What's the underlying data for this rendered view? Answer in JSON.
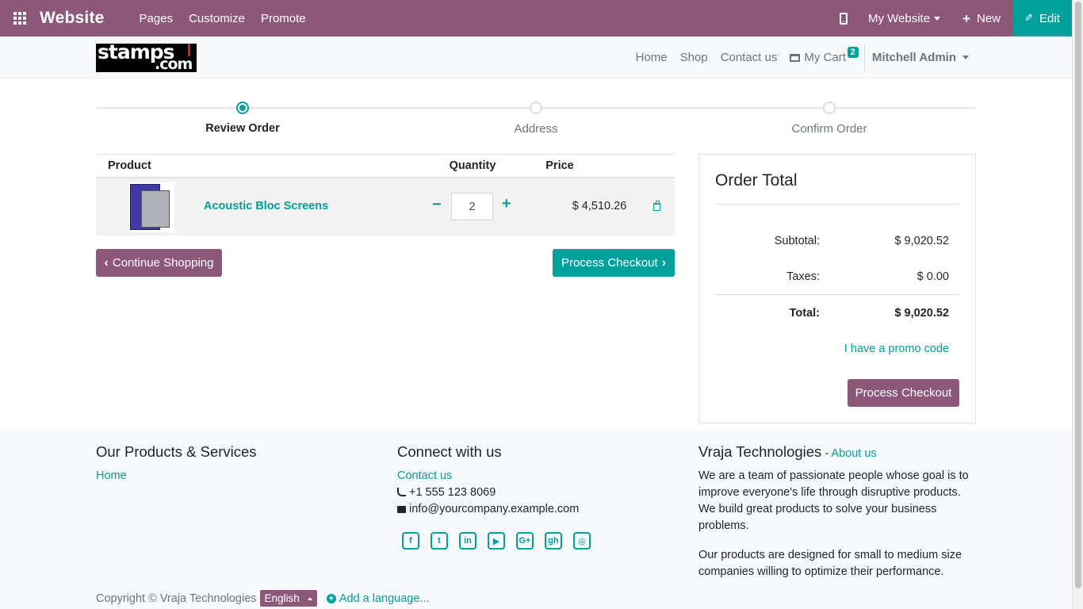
{
  "topbar": {
    "brand": "Website",
    "nav": [
      "Pages",
      "Customize",
      "Promote"
    ],
    "my_website": "My Website",
    "new_label": "New",
    "edit_label": "Edit",
    "bg_color": "#8c5779",
    "accent_color": "#00a09d"
  },
  "header": {
    "logo_line1": "stamps",
    "logo_line2": ".com",
    "nav": [
      "Home",
      "Shop",
      "Contact us"
    ],
    "cart_label": "My Cart",
    "cart_count": "2",
    "user": "Mitchell Admin"
  },
  "steps": [
    {
      "label": "Review Order",
      "active": true
    },
    {
      "label": "Address",
      "active": false
    },
    {
      "label": "Confirm Order",
      "active": false
    }
  ],
  "cart": {
    "headers": {
      "product": "Product",
      "quantity": "Quantity",
      "price": "Price"
    },
    "items": [
      {
        "name": "Acoustic Bloc Screens",
        "quantity": "2",
        "price": "$ 4,510.26"
      }
    ],
    "continue_label": "Continue Shopping",
    "checkout_label": "Process Checkout"
  },
  "order_total": {
    "title": "Order Total",
    "subtotal_label": "Subtotal:",
    "subtotal": "$ 9,020.52",
    "taxes_label": "Taxes:",
    "taxes": "$ 0.00",
    "total_label": "Total:",
    "total": "$ 9,020.52",
    "promo_label": "I have a promo code",
    "checkout_label": "Process Checkout"
  },
  "footer": {
    "col1_title": "Our Products & Services",
    "col1_link": "Home",
    "col2_title": "Connect with us",
    "col2_link": "Contact us",
    "phone": "+1 555 123 8069",
    "email": "info@yourcompany.example.com",
    "social_icons": [
      "facebook-icon",
      "twitter-icon",
      "linkedin-icon",
      "youtube-icon",
      "google-plus-icon",
      "github-icon",
      "instagram-icon"
    ],
    "col3_title": "Vraja Technologies",
    "col3_sep": " - ",
    "col3_link": "About us",
    "about_p1": "We are a team of passionate people whose goal is to improve everyone's life through disruptive products. We build great products to solve your business problems.",
    "about_p2": "Our products are designed for small to medium size companies willing to optimize their performance.",
    "copyright": "Copyright © Vraja Technologies",
    "language": "English",
    "add_language": "Add a language..."
  }
}
